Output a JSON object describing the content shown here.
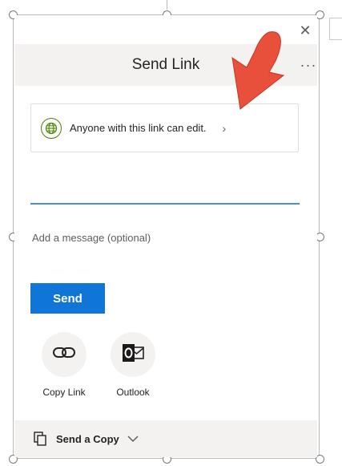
{
  "dialog": {
    "close_glyph": "✕",
    "more_glyph": "···",
    "title": "Send Link"
  },
  "link_setting": {
    "text": "Anyone with this link can edit.",
    "chevron": "›"
  },
  "recipients": {
    "value": ""
  },
  "message": {
    "placeholder": "Add a message (optional)"
  },
  "send_button": {
    "label": "Send"
  },
  "share_options": [
    {
      "label": "Copy Link",
      "icon": "link-icon"
    },
    {
      "label": "Outlook",
      "icon": "outlook-icon"
    }
  ],
  "footer": {
    "label": "Send a Copy",
    "icon": "copy-icon"
  },
  "colors": {
    "accent": "#0f75d7",
    "header_bg": "#f3f2f1",
    "arrow": "#e8503c",
    "globe": "#498205"
  }
}
